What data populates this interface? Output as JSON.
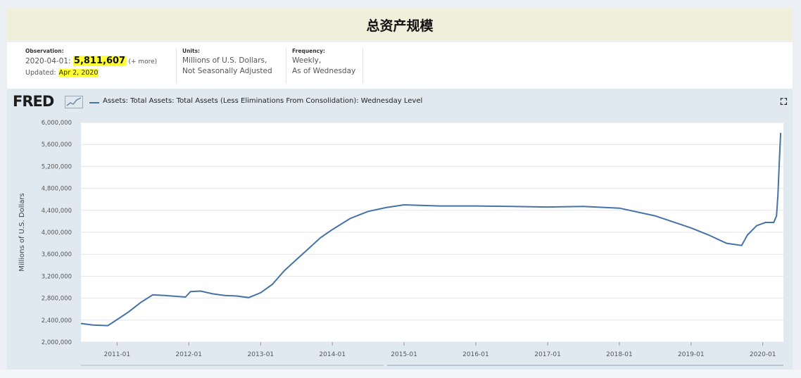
{
  "banner": {
    "title": "总资产规模"
  },
  "info": {
    "observation_label": "Observation:",
    "observation_date": "2020-04-01:",
    "observation_value": "5,811,607",
    "observation_more": "(+ more)",
    "updated_label": "Updated:",
    "updated_value": "Apr 2, 2020",
    "units_label": "Units:",
    "units_line1": "Millions of U.S. Dollars,",
    "units_line2": "Not Seasonally Adjusted",
    "frequency_label": "Frequency:",
    "frequency_line1": "Weekly,",
    "frequency_line2": "As of Wednesday"
  },
  "header": {
    "logo": "FRED",
    "fullscreen_icon": "expand-icon",
    "logo_mark_icon": "chart-line-icon"
  },
  "colors": {
    "series": "#4572a7",
    "banner": "#eef0dc",
    "highlight": "#ffff33",
    "panel": "#e1e9f0"
  },
  "chart_data": {
    "type": "line",
    "title": "",
    "xlabel": "",
    "ylabel": "Millions of U.S. Dollars",
    "ylim": [
      2000000,
      6000000
    ],
    "xlim": [
      "2010-07-01",
      "2020-04-15"
    ],
    "y_ticks": [
      2000000,
      2400000,
      2800000,
      3200000,
      3600000,
      4000000,
      4400000,
      4800000,
      5200000,
      5600000,
      6000000
    ],
    "y_tick_labels": [
      "2,000,000",
      "2,400,000",
      "2,800,000",
      "3,200,000",
      "3,600,000",
      "4,000,000",
      "4,400,000",
      "4,800,000",
      "5,200,000",
      "5,600,000",
      "6,000,000"
    ],
    "x_ticks": [
      "2011-01",
      "2012-01",
      "2013-01",
      "2014-01",
      "2015-01",
      "2016-01",
      "2017-01",
      "2018-01",
      "2019-01",
      "2020-01"
    ],
    "grid": true,
    "legend": "top-left",
    "series": [
      {
        "name": "Assets: Total Assets: Total Assets (Less Eliminations From Consolidation): Wednesday Level",
        "points": [
          [
            "2010-07-01",
            2340000
          ],
          [
            "2010-09-01",
            2310000
          ],
          [
            "2010-11-15",
            2300000
          ],
          [
            "2011-01-01",
            2410000
          ],
          [
            "2011-03-01",
            2550000
          ],
          [
            "2011-05-01",
            2720000
          ],
          [
            "2011-07-01",
            2860000
          ],
          [
            "2011-09-01",
            2850000
          ],
          [
            "2011-12-15",
            2820000
          ],
          [
            "2012-01-10",
            2920000
          ],
          [
            "2012-03-01",
            2930000
          ],
          [
            "2012-05-01",
            2880000
          ],
          [
            "2012-07-01",
            2850000
          ],
          [
            "2012-09-01",
            2840000
          ],
          [
            "2012-11-01",
            2810000
          ],
          [
            "2013-01-01",
            2900000
          ],
          [
            "2013-03-01",
            3050000
          ],
          [
            "2013-05-01",
            3300000
          ],
          [
            "2013-07-01",
            3500000
          ],
          [
            "2013-09-01",
            3700000
          ],
          [
            "2013-11-01",
            3900000
          ],
          [
            "2014-01-01",
            4050000
          ],
          [
            "2014-04-01",
            4250000
          ],
          [
            "2014-07-01",
            4380000
          ],
          [
            "2014-10-01",
            4450000
          ],
          [
            "2015-01-01",
            4500000
          ],
          [
            "2015-07-01",
            4480000
          ],
          [
            "2016-01-01",
            4480000
          ],
          [
            "2016-07-01",
            4470000
          ],
          [
            "2017-01-01",
            4460000
          ],
          [
            "2017-07-01",
            4470000
          ],
          [
            "2018-01-01",
            4440000
          ],
          [
            "2018-07-01",
            4300000
          ],
          [
            "2019-01-01",
            4080000
          ],
          [
            "2019-04-01",
            3950000
          ],
          [
            "2019-07-01",
            3800000
          ],
          [
            "2019-09-15",
            3760000
          ],
          [
            "2019-10-15",
            3950000
          ],
          [
            "2019-12-01",
            4120000
          ],
          [
            "2020-01-15",
            4180000
          ],
          [
            "2020-02-26",
            4180000
          ],
          [
            "2020-03-11",
            4300000
          ],
          [
            "2020-03-18",
            4670000
          ],
          [
            "2020-03-25",
            5250000
          ],
          [
            "2020-04-01",
            5811607
          ]
        ]
      }
    ]
  }
}
